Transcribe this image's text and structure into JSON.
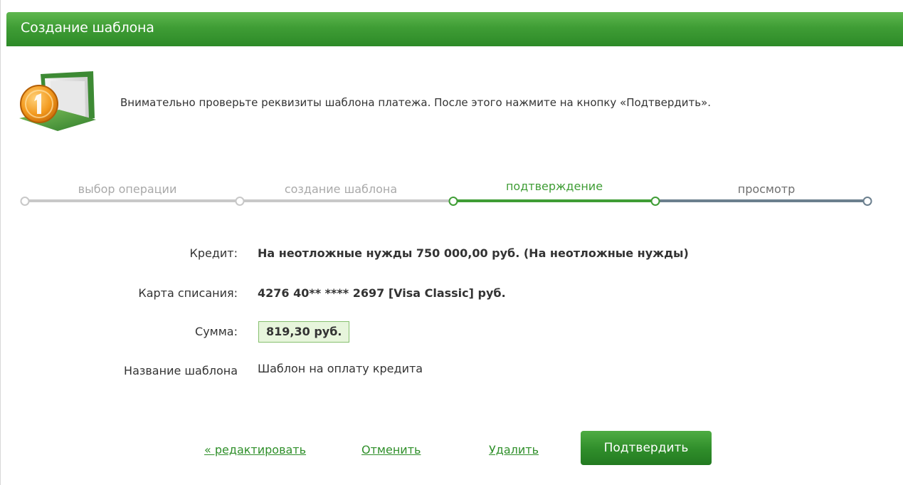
{
  "header": {
    "title": "Создание шаблона"
  },
  "notice": {
    "text": "Внимательно проверьте реквизиты шаблона платежа. После этого нажмите на кнопку «Подтвердить».",
    "icon": "folder-coin-icon"
  },
  "steps": [
    {
      "label": "выбор операции",
      "state": "done"
    },
    {
      "label": "создание шаблона",
      "state": "done"
    },
    {
      "label": "подтверждение",
      "state": "active"
    },
    {
      "label": "просмотр",
      "state": "future"
    }
  ],
  "colors": {
    "brand_green": "#3f9d35",
    "done_line": "#c8c8c8",
    "future_line": "#6b7f8e",
    "amount_bg": "#e7f5dc"
  },
  "details": {
    "credit": {
      "label": "Кредит:",
      "value": "На неотложные нужды  750 000,00  руб.  (На неотложные нужды)"
    },
    "card": {
      "label": "Карта списания:",
      "value": "4276 40** **** 2697  [Visa Classic]  руб."
    },
    "amount": {
      "label": "Сумма:",
      "value": "819,30  руб."
    },
    "template_name": {
      "label": "Название шаблона",
      "value": "Шаблон на оплату кредита"
    }
  },
  "actions": {
    "edit": "« редактировать",
    "cancel": "Отменить",
    "delete": "Удалить",
    "confirm": "Подтвердить"
  }
}
